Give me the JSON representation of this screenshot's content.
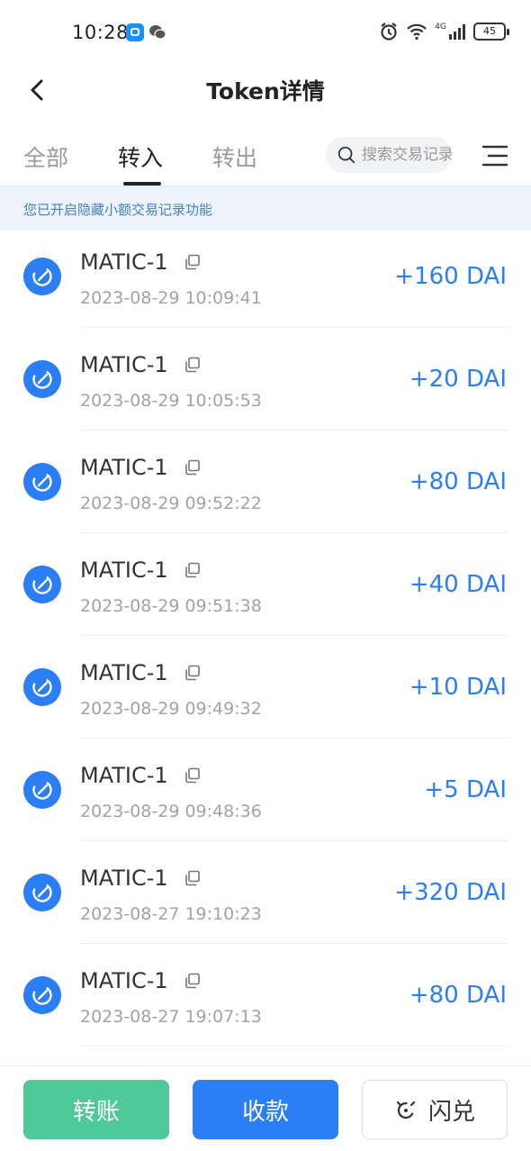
{
  "status": {
    "time": "10:28",
    "battery": "45",
    "network": "4G"
  },
  "header": {
    "title": "Token详情"
  },
  "tabs": [
    {
      "label": "全部"
    },
    {
      "label": "转入"
    },
    {
      "label": "转出"
    }
  ],
  "active_tab": "转入",
  "search": {
    "placeholder": "搜索交易记录"
  },
  "notice": {
    "text": "您已开启隐藏小额交易记录功能"
  },
  "transactions": [
    {
      "name": "MATIC-1",
      "time": "2023-08-29 10:09:41",
      "amount": "+160 DAI"
    },
    {
      "name": "MATIC-1",
      "time": "2023-08-29 10:05:53",
      "amount": "+20 DAI"
    },
    {
      "name": "MATIC-1",
      "time": "2023-08-29 09:52:22",
      "amount": "+80 DAI"
    },
    {
      "name": "MATIC-1",
      "time": "2023-08-29 09:51:38",
      "amount": "+40 DAI"
    },
    {
      "name": "MATIC-1",
      "time": "2023-08-29 09:49:32",
      "amount": "+10 DAI"
    },
    {
      "name": "MATIC-1",
      "time": "2023-08-29 09:48:36",
      "amount": "+5 DAI"
    },
    {
      "name": "MATIC-1",
      "time": "2023-08-27 19:10:23",
      "amount": "+320 DAI"
    },
    {
      "name": "MATIC-1",
      "time": "2023-08-27 19:07:13",
      "amount": "+80 DAI"
    }
  ],
  "actions": {
    "transfer": "转账",
    "receive": "收款",
    "swap": "闪兑"
  },
  "colors": {
    "accent": "#2b7ef6",
    "transfer_button": "#4fc89a",
    "notice_bg": "#eef4fc",
    "notice_text": "#3f7fd6"
  }
}
